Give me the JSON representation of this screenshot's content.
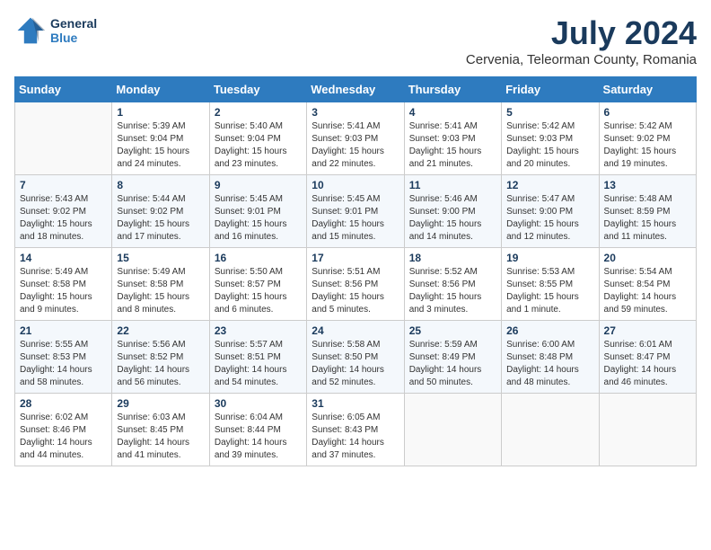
{
  "header": {
    "logo_line1": "General",
    "logo_line2": "Blue",
    "month": "July 2024",
    "location": "Cervenia, Teleorman County, Romania"
  },
  "days_of_week": [
    "Sunday",
    "Monday",
    "Tuesday",
    "Wednesday",
    "Thursday",
    "Friday",
    "Saturday"
  ],
  "weeks": [
    [
      {
        "day": "",
        "info": ""
      },
      {
        "day": "1",
        "info": "Sunrise: 5:39 AM\nSunset: 9:04 PM\nDaylight: 15 hours\nand 24 minutes."
      },
      {
        "day": "2",
        "info": "Sunrise: 5:40 AM\nSunset: 9:04 PM\nDaylight: 15 hours\nand 23 minutes."
      },
      {
        "day": "3",
        "info": "Sunrise: 5:41 AM\nSunset: 9:03 PM\nDaylight: 15 hours\nand 22 minutes."
      },
      {
        "day": "4",
        "info": "Sunrise: 5:41 AM\nSunset: 9:03 PM\nDaylight: 15 hours\nand 21 minutes."
      },
      {
        "day": "5",
        "info": "Sunrise: 5:42 AM\nSunset: 9:03 PM\nDaylight: 15 hours\nand 20 minutes."
      },
      {
        "day": "6",
        "info": "Sunrise: 5:42 AM\nSunset: 9:02 PM\nDaylight: 15 hours\nand 19 minutes."
      }
    ],
    [
      {
        "day": "7",
        "info": "Sunrise: 5:43 AM\nSunset: 9:02 PM\nDaylight: 15 hours\nand 18 minutes."
      },
      {
        "day": "8",
        "info": "Sunrise: 5:44 AM\nSunset: 9:02 PM\nDaylight: 15 hours\nand 17 minutes."
      },
      {
        "day": "9",
        "info": "Sunrise: 5:45 AM\nSunset: 9:01 PM\nDaylight: 15 hours\nand 16 minutes."
      },
      {
        "day": "10",
        "info": "Sunrise: 5:45 AM\nSunset: 9:01 PM\nDaylight: 15 hours\nand 15 minutes."
      },
      {
        "day": "11",
        "info": "Sunrise: 5:46 AM\nSunset: 9:00 PM\nDaylight: 15 hours\nand 14 minutes."
      },
      {
        "day": "12",
        "info": "Sunrise: 5:47 AM\nSunset: 9:00 PM\nDaylight: 15 hours\nand 12 minutes."
      },
      {
        "day": "13",
        "info": "Sunrise: 5:48 AM\nSunset: 8:59 PM\nDaylight: 15 hours\nand 11 minutes."
      }
    ],
    [
      {
        "day": "14",
        "info": "Sunrise: 5:49 AM\nSunset: 8:58 PM\nDaylight: 15 hours\nand 9 minutes."
      },
      {
        "day": "15",
        "info": "Sunrise: 5:49 AM\nSunset: 8:58 PM\nDaylight: 15 hours\nand 8 minutes."
      },
      {
        "day": "16",
        "info": "Sunrise: 5:50 AM\nSunset: 8:57 PM\nDaylight: 15 hours\nand 6 minutes."
      },
      {
        "day": "17",
        "info": "Sunrise: 5:51 AM\nSunset: 8:56 PM\nDaylight: 15 hours\nand 5 minutes."
      },
      {
        "day": "18",
        "info": "Sunrise: 5:52 AM\nSunset: 8:56 PM\nDaylight: 15 hours\nand 3 minutes."
      },
      {
        "day": "19",
        "info": "Sunrise: 5:53 AM\nSunset: 8:55 PM\nDaylight: 15 hours\nand 1 minute."
      },
      {
        "day": "20",
        "info": "Sunrise: 5:54 AM\nSunset: 8:54 PM\nDaylight: 14 hours\nand 59 minutes."
      }
    ],
    [
      {
        "day": "21",
        "info": "Sunrise: 5:55 AM\nSunset: 8:53 PM\nDaylight: 14 hours\nand 58 minutes."
      },
      {
        "day": "22",
        "info": "Sunrise: 5:56 AM\nSunset: 8:52 PM\nDaylight: 14 hours\nand 56 minutes."
      },
      {
        "day": "23",
        "info": "Sunrise: 5:57 AM\nSunset: 8:51 PM\nDaylight: 14 hours\nand 54 minutes."
      },
      {
        "day": "24",
        "info": "Sunrise: 5:58 AM\nSunset: 8:50 PM\nDaylight: 14 hours\nand 52 minutes."
      },
      {
        "day": "25",
        "info": "Sunrise: 5:59 AM\nSunset: 8:49 PM\nDaylight: 14 hours\nand 50 minutes."
      },
      {
        "day": "26",
        "info": "Sunrise: 6:00 AM\nSunset: 8:48 PM\nDaylight: 14 hours\nand 48 minutes."
      },
      {
        "day": "27",
        "info": "Sunrise: 6:01 AM\nSunset: 8:47 PM\nDaylight: 14 hours\nand 46 minutes."
      }
    ],
    [
      {
        "day": "28",
        "info": "Sunrise: 6:02 AM\nSunset: 8:46 PM\nDaylight: 14 hours\nand 44 minutes."
      },
      {
        "day": "29",
        "info": "Sunrise: 6:03 AM\nSunset: 8:45 PM\nDaylight: 14 hours\nand 41 minutes."
      },
      {
        "day": "30",
        "info": "Sunrise: 6:04 AM\nSunset: 8:44 PM\nDaylight: 14 hours\nand 39 minutes."
      },
      {
        "day": "31",
        "info": "Sunrise: 6:05 AM\nSunset: 8:43 PM\nDaylight: 14 hours\nand 37 minutes."
      },
      {
        "day": "",
        "info": ""
      },
      {
        "day": "",
        "info": ""
      },
      {
        "day": "",
        "info": ""
      }
    ]
  ]
}
